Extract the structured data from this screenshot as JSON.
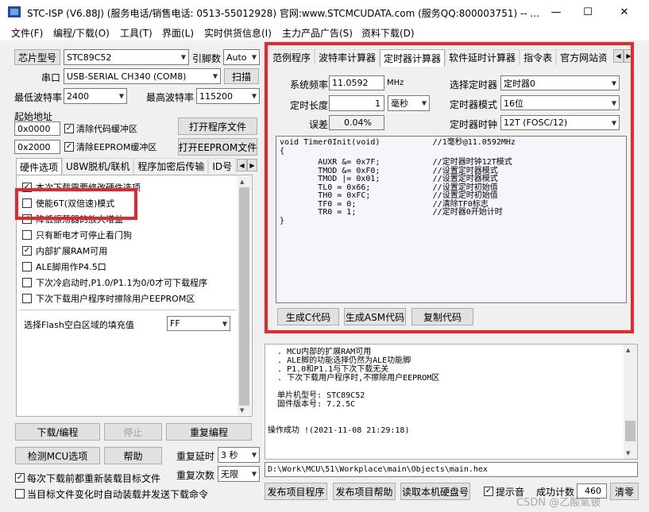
{
  "window": {
    "title": "STC-ISP (V6.88J) (服务电话/销售电话: 0513-55012928) 官网:www.STCMCUDATA.com  (服务QQ:800003751) -- ...",
    "controls": {
      "minimize": "—",
      "maximize": "☐",
      "close": "✕"
    }
  },
  "menu": [
    "文件(F)",
    "编程/下载(O)",
    "工具(T)",
    "界面(L)",
    "实时供货信息(I)",
    "主力产品广告(S)",
    "资料下载(D)"
  ],
  "left": {
    "chip_btn": "芯片型号",
    "chip_value": "STC89C52",
    "pin_label": "引脚数",
    "pin_value": "Auto",
    "port_label": "串口",
    "port_value": "USB-SERIAL CH340 (COM8)",
    "scan_btn": "扫描",
    "min_baud_label": "最低波特率",
    "min_baud_value": "2400",
    "max_baud_label": "最高波特率",
    "max_baud_value": "115200",
    "start_addr_label": "起始地址",
    "addr1": "0x0000",
    "clear_code_label": "清除代码缓冲区",
    "open_prog_btn": "打开程序文件",
    "addr2": "0x2000",
    "clear_eeprom_label": "清除EEPROM缓冲区",
    "open_eeprom_btn": "打开EEPROM文件",
    "tabs": [
      "硬件选项",
      "U8W脱机/联机",
      "程序加密后传输",
      "ID号"
    ],
    "options": [
      {
        "label": "本次下载需要修改硬件选项",
        "checked": true
      },
      {
        "label": "使能6T(双倍速)模式",
        "checked": false
      },
      {
        "label": "降低振荡器的放大增益",
        "checked": true
      },
      {
        "label": "只有断电才可停止看门狗",
        "checked": false
      },
      {
        "label": "内部扩展RAM可用",
        "checked": true
      },
      {
        "label": "ALE脚用作P4.5口",
        "checked": false
      },
      {
        "label": "下次冷启动时,P1.0/P1.1为0/0才可下载程序",
        "checked": false
      },
      {
        "label": "下次下载用户程序时擦除用户EEPROM区",
        "checked": false
      }
    ],
    "flash_fill_label": "选择Flash空白区域的填充值",
    "flash_fill_value": "FF",
    "download_btn": "下载/编程",
    "stop_btn": "停止",
    "reprogram_btn": "重复编程",
    "check_mcu_btn": "检测MCU选项",
    "help_btn": "帮助",
    "repeat_delay_label": "重复延时",
    "repeat_delay_value": "3 秒",
    "repeat_count_label": "重复次数",
    "repeat_count_value": "无限",
    "reload_label": "每次下载前都重新装载目标文件",
    "reload_checked": true,
    "auto_label": "当目标文件变化时自动装载并发送下载命令",
    "auto_checked": false
  },
  "right": {
    "tabs": [
      "范例程序",
      "波特率计算器",
      "定时器计算器",
      "软件延时计算器",
      "指令表",
      "官方网站资"
    ],
    "active_tab": 2,
    "sysclk_label": "系统频率",
    "sysclk_value": "11.0592",
    "sysclk_unit": "MHz",
    "select_timer_label": "选择定时器",
    "select_timer_value": "定时器0",
    "length_label": "定时长度",
    "length_value": "1",
    "length_unit": "毫秒",
    "timer_mode_label": "定时器模式",
    "timer_mode_value": "16位",
    "error_label": "误差",
    "error_value": "0.04%",
    "timer_clock_label": "定时器时钟",
    "timer_clock_value": "12T (FOSC/12)",
    "code_lines": [
      "void Timer0Init(void)\t\t//1毫秒@11.0592MHz",
      "{",
      "\tAUXR &= 0x7F;\t\t//定时器时钟12T模式",
      "\tTMOD &= 0xF0;\t\t//设置定时器模式",
      "\tTMOD |= 0x01;\t\t//设置定时器模式",
      "\tTL0 = 0x66;\t\t//设置定时初始值",
      "\tTH0 = 0xFC;\t\t//设置定时初始值",
      "\tTF0 = 0;\t\t//清除TF0标志",
      "\tTR0 = 1;\t\t//定时器0开始计时",
      "}"
    ],
    "gen_c_btn": "生成C代码",
    "gen_asm_btn": "生成ASM代码",
    "copy_btn": "复制代码",
    "log_lines": [
      "  . MCU内部的扩展RAM可用",
      "  . ALE脚的功能选择仍然为ALE功能脚",
      "  . P1.0和P1.1与下次下载无关",
      "  . 下次下载用户程序时,不擦除用户EEPROM区",
      "",
      "  单片机型号: STC89C52",
      "  固件版本号: 7.2.5C",
      "",
      "",
      "操作成功 !(2021-11-08 21:29:18)"
    ],
    "file_path": "D:\\Work\\MCU\\51\\Workplace\\main\\Objects\\main.hex",
    "publish_btn": "发布项目程序",
    "publish_help_btn": "发布项目帮助",
    "read_disk_btn": "读取本机硬盘号",
    "prompt_label": "提示音",
    "prompt_checked": true,
    "success_label": "成功计数",
    "success_value": "460",
    "clear_btn": "清零"
  },
  "watermark": "CSDN @乙酸氧铍",
  "colors": {
    "highlight": "#e8262d",
    "window_bg": "#f0f0f0"
  }
}
